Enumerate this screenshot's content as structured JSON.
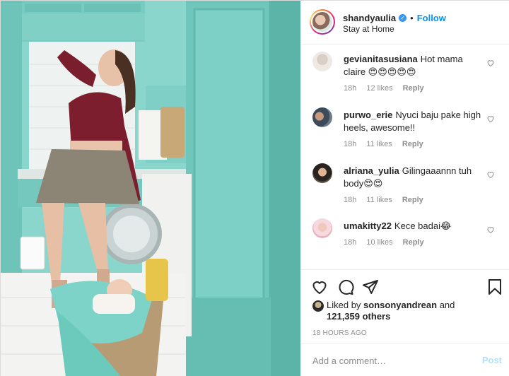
{
  "header": {
    "username": "shandyaulia",
    "verified_icon": "verified-badge-icon",
    "separator": "•",
    "follow_label": "Follow",
    "location": "Stay at Home"
  },
  "comments": [
    {
      "user": "gevianitasusiana",
      "text": "Hot mama claire 😍😍😍😍😍",
      "age": "18h",
      "likes": "12 likes",
      "reply": "Reply"
    },
    {
      "user": "purwo_erie",
      "text": "Nyuci baju pake high heels, awesome!!",
      "age": "18h",
      "likes": "11 likes",
      "reply": "Reply"
    },
    {
      "user": "alriana_yulia",
      "text": "Gilingaaannn tuh body😍😍",
      "age": "18h",
      "likes": "11 likes",
      "reply": "Reply"
    },
    {
      "user": "umakitty22",
      "text": "Kece badai😂",
      "age": "18h",
      "likes": "10 likes",
      "reply": "Reply"
    }
  ],
  "actions": {
    "icons": [
      "heart-icon",
      "comment-icon",
      "share-icon",
      "bookmark-icon"
    ],
    "liked_prefix": "Liked by",
    "liked_user": "sonsonyandrean",
    "liked_and": "and",
    "liked_count": "121,359 others",
    "timestamp": "18 HOURS AGO"
  },
  "add_comment": {
    "placeholder": "Add a comment…",
    "post_label": "Post"
  },
  "colors": {
    "accent": "#0095f6",
    "post_disabled": "#b2dffc",
    "muted": "#8e8e8e",
    "teal": "#7fcfc6"
  }
}
